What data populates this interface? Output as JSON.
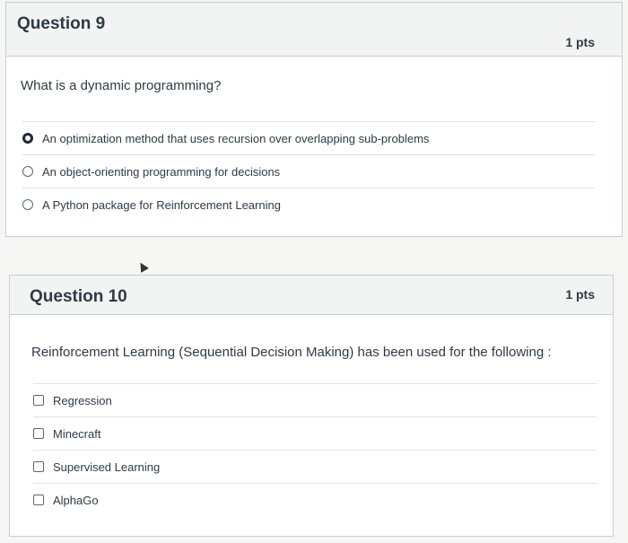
{
  "question9": {
    "title": "Question 9",
    "points": "1 pts",
    "text": "What is a dynamic programming?",
    "answers": [
      {
        "label": "An optimization method that uses recursion over overlapping sub-problems",
        "selected": true
      },
      {
        "label": "An object-orienting programming for decisions",
        "selected": false
      },
      {
        "label": "A Python package for Reinforcement Learning",
        "selected": false
      }
    ]
  },
  "question10": {
    "title": "Question 10",
    "points": "1 pts",
    "text": "Reinforcement Learning (Sequential Decision Making) has been used for the following :",
    "answers": [
      {
        "label": "Regression",
        "checked": false
      },
      {
        "label": "Minecraft",
        "checked": false
      },
      {
        "label": "Supervised Learning",
        "checked": false
      },
      {
        "label": "AlphaGo",
        "checked": false
      }
    ]
  }
}
